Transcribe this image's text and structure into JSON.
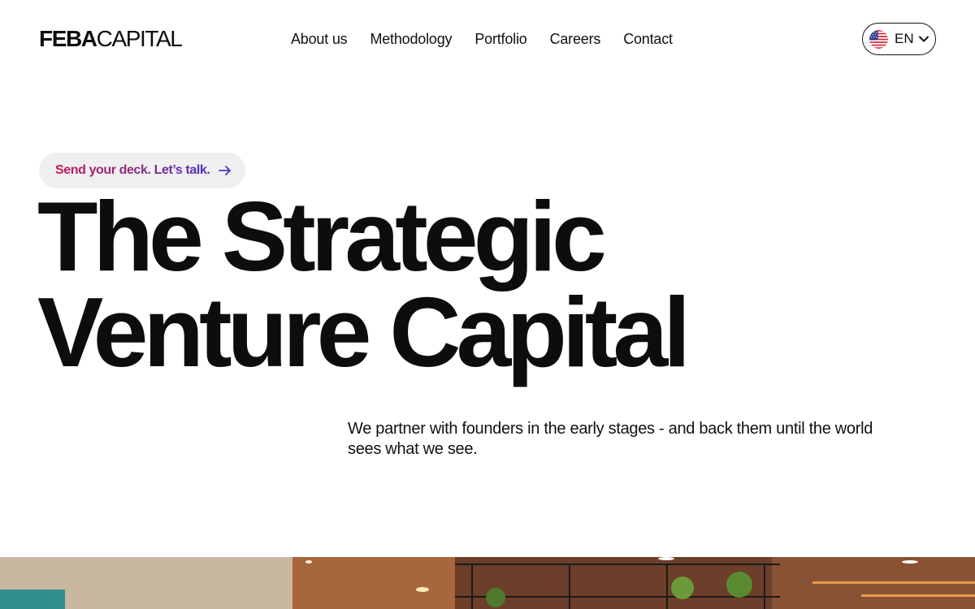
{
  "header": {
    "logo_bold": "FEBA",
    "logo_light": "CAPITAL",
    "nav": [
      "About us",
      "Methodology",
      "Portfolio",
      "Careers",
      "Contact"
    ],
    "language": "EN"
  },
  "hero": {
    "cta": "Send your deck. Let’s talk.",
    "headline_line1": "The Strategic",
    "headline_line2": "Venture Capital",
    "subtext": "We partner with founders in the early stages - and back them until the world sees what we see."
  },
  "icons": {
    "flag": "us-flag-icon",
    "chevron": "chevron-down-icon",
    "arrow": "arrow-right-icon"
  },
  "colors": {
    "cta_gradient_start": "#c2185b",
    "cta_gradient_end": "#4b2ec8",
    "pill_bg": "#efefef",
    "text": "#0d0d0d"
  }
}
